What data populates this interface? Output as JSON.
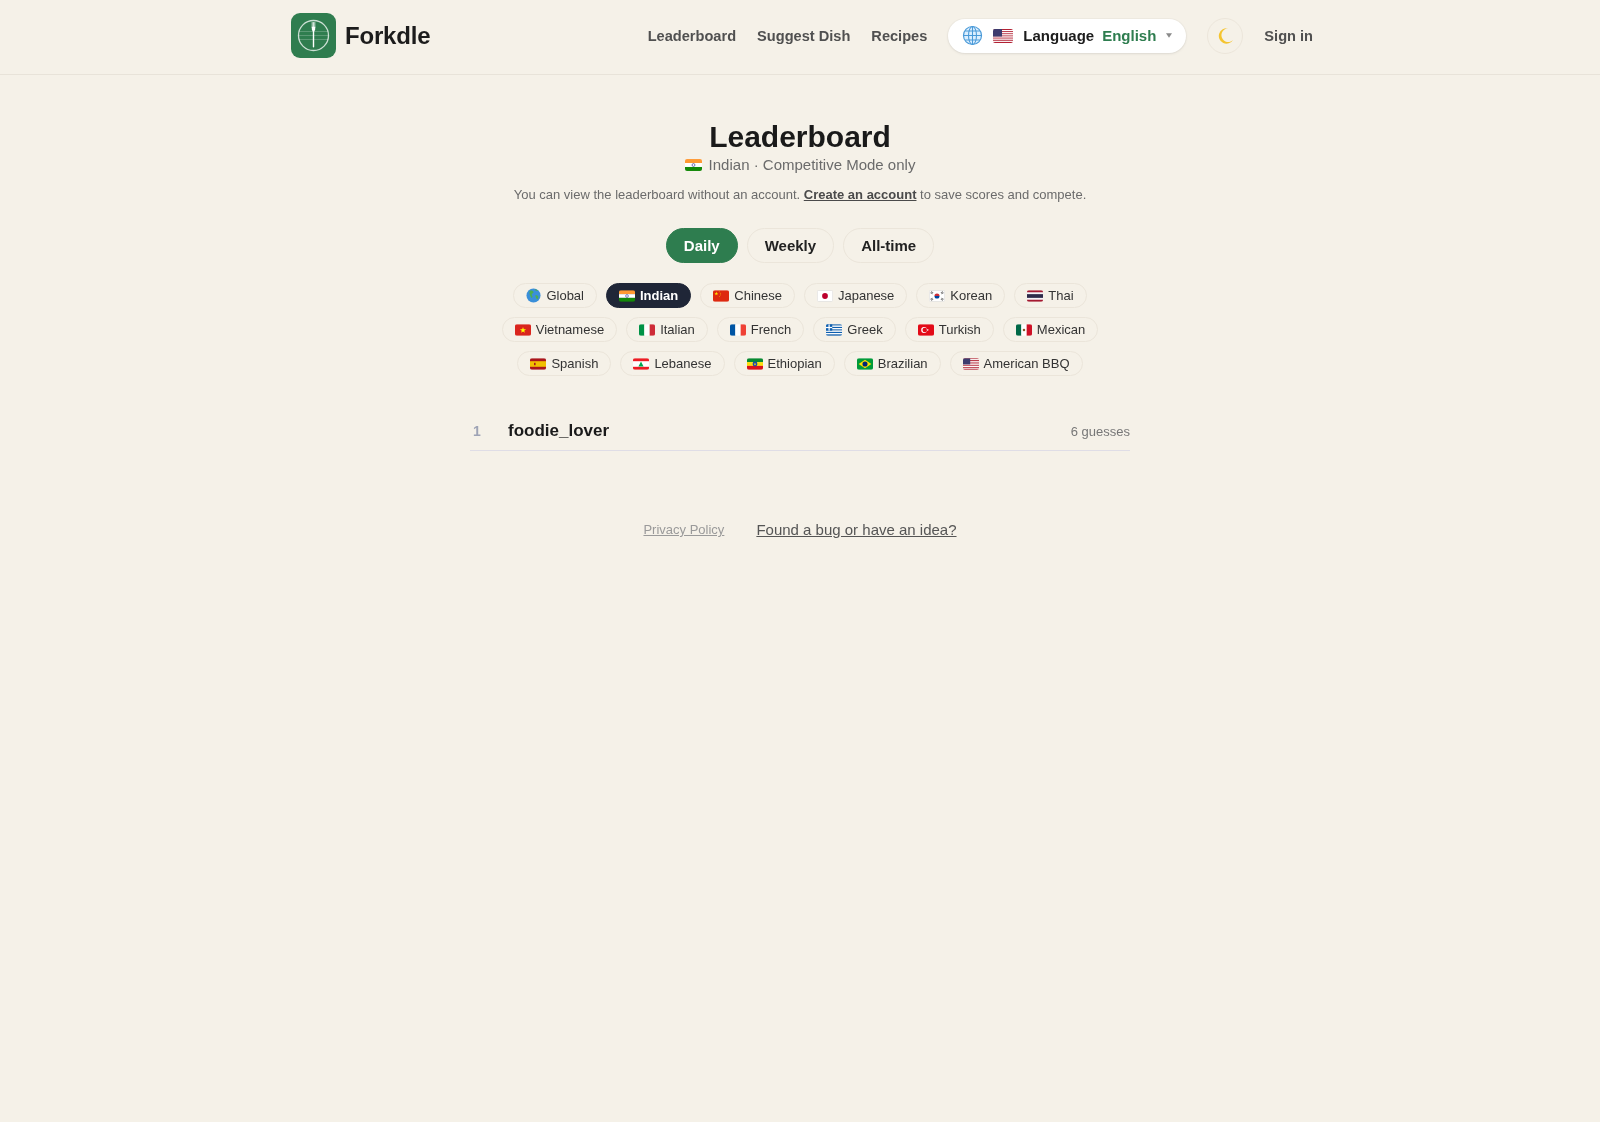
{
  "header": {
    "brand": "Forkdle",
    "nav": [
      "Leaderboard",
      "Suggest Dish",
      "Recipes"
    ],
    "language": {
      "label": "Language",
      "value": "English"
    },
    "sign_in": "Sign in"
  },
  "hero": {
    "title": "Leaderboard",
    "subtitle": "Indian · Competitive Mode only",
    "notice": {
      "before": "You can view the leaderboard without an account.",
      "link": "Create an account",
      "after": "to save scores and compete."
    }
  },
  "periods": [
    {
      "label": "Daily",
      "selected": true
    },
    {
      "label": "Weekly",
      "selected": false
    },
    {
      "label": "All-time",
      "selected": false
    }
  ],
  "cuisines": [
    {
      "label": "Global",
      "selected": false
    },
    {
      "label": "Indian",
      "selected": true
    },
    {
      "label": "Chinese",
      "selected": false
    },
    {
      "label": "Japanese",
      "selected": false
    },
    {
      "label": "Korean",
      "selected": false
    },
    {
      "label": "Thai",
      "selected": false
    },
    {
      "label": "Vietnamese",
      "selected": false
    },
    {
      "label": "Italian",
      "selected": false
    },
    {
      "label": "French",
      "selected": false
    },
    {
      "label": "Greek",
      "selected": false
    },
    {
      "label": "Turkish",
      "selected": false
    },
    {
      "label": "Mexican",
      "selected": false
    },
    {
      "label": "Spanish",
      "selected": false
    },
    {
      "label": "Lebanese",
      "selected": false
    },
    {
      "label": "Ethiopian",
      "selected": false
    },
    {
      "label": "Brazilian",
      "selected": false
    },
    {
      "label": "American BBQ",
      "selected": false
    }
  ],
  "leaderboard": {
    "rows": [
      {
        "rank": "1",
        "name": "foodie_lover",
        "score": "6 guesses"
      }
    ]
  },
  "footer": {
    "links": [
      {
        "kind": "privacy",
        "label": "Privacy Policy"
      },
      {
        "kind": "feedback",
        "label": "Found a bug or have an idea?"
      }
    ]
  }
}
